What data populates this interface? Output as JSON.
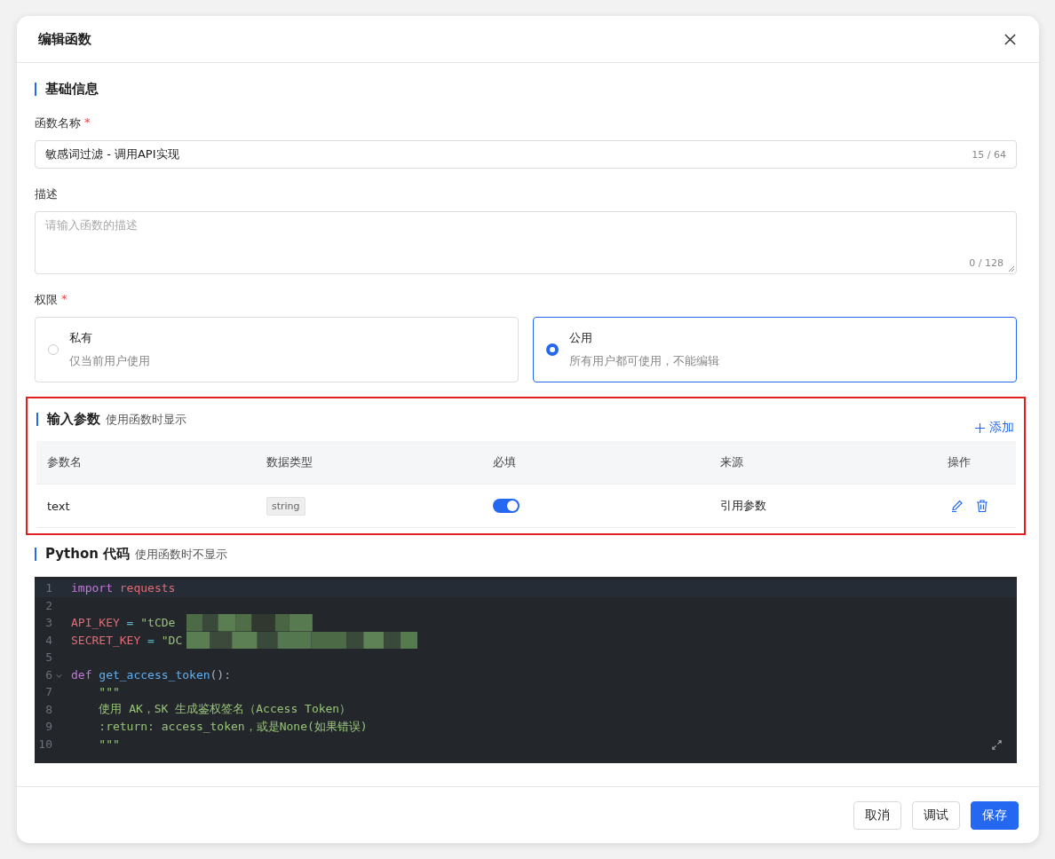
{
  "dialog": {
    "title": "编辑函数"
  },
  "basic": {
    "title": "基础信息",
    "name_field": {
      "label": "函数名称",
      "required_mark": "*",
      "value": "敏感词过滤 - 调用API实现",
      "counter": "15 / 64"
    },
    "description_field": {
      "label": "描述",
      "placeholder": "请输入函数的描述",
      "counter": "0 / 128"
    },
    "permission": {
      "label": "权限",
      "required_mark": "*",
      "options": [
        {
          "title": "私有",
          "hint": "仅当前用户使用",
          "selected": false
        },
        {
          "title": "公用",
          "hint": "所有用户都可使用，不能编辑",
          "selected": true
        }
      ]
    }
  },
  "input_params": {
    "title": "输入参数",
    "subtitle": "使用函数时显示",
    "highlighted": true,
    "add_button": "添加",
    "columns": [
      "参数名",
      "数据类型",
      "必填",
      "来源",
      "操作"
    ],
    "rows": [
      {
        "name": "text",
        "type": "string",
        "required": true,
        "source": "引用参数"
      }
    ]
  },
  "code": {
    "title": "Python 代码",
    "subtitle": "使用函数时不显示",
    "lines": [
      {
        "number": "1",
        "tokens": [
          {
            "text": "import",
            "kind": "keyword"
          },
          {
            "text": " requests",
            "kind": "variable"
          }
        ]
      },
      {
        "number": "2"
      },
      {
        "number": "3",
        "redacted": true,
        "tokens": [
          {
            "text": "API_KEY",
            "kind": "variable"
          },
          {
            "text": " = ",
            "kind": "operator"
          },
          {
            "text": "\"tCDe",
            "kind": "string"
          }
        ]
      },
      {
        "number": "4",
        "redacted": true,
        "tokens": [
          {
            "text": "SECRET_KEY",
            "kind": "variable"
          },
          {
            "text": " = ",
            "kind": "operator"
          },
          {
            "text": "\"DC",
            "kind": "string"
          }
        ]
      },
      {
        "number": "5"
      },
      {
        "number": "6",
        "foldable": true,
        "tokens": [
          {
            "text": "def ",
            "kind": "keyword"
          },
          {
            "text": "get_access_token",
            "kind": "function"
          },
          {
            "text": "():",
            "kind": "plain"
          }
        ]
      },
      {
        "number": "7",
        "tokens": [
          {
            "text": "    \"\"\"",
            "kind": "string"
          }
        ]
      },
      {
        "number": "8",
        "tokens": [
          {
            "text": "    使用 AK，SK 生成鉴权签名（Access Token）",
            "kind": "string"
          }
        ]
      },
      {
        "number": "9",
        "tokens": [
          {
            "text": "    :return: access_token，或是None(如果错误)",
            "kind": "string"
          }
        ]
      },
      {
        "number": "10",
        "tokens": [
          {
            "text": "    \"\"\"",
            "kind": "string"
          }
        ]
      }
    ]
  },
  "footer": {
    "buttons": [
      {
        "label": "取消",
        "kind": "default"
      },
      {
        "label": "调试",
        "kind": "default"
      },
      {
        "label": "保存",
        "kind": "primary"
      }
    ]
  }
}
